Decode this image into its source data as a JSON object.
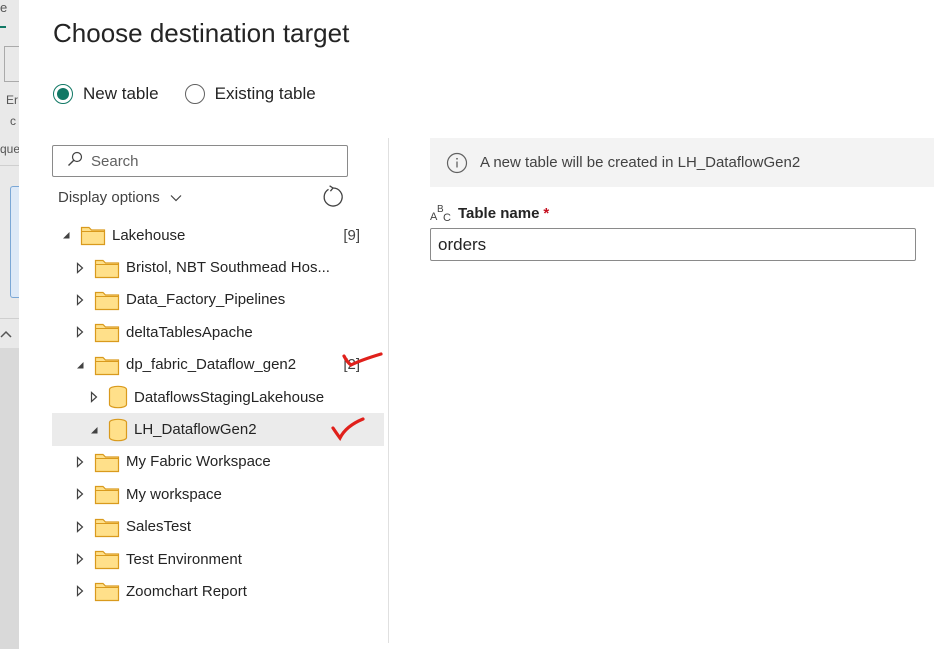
{
  "background_app": {
    "fragments": [
      "e",
      "Er",
      "c",
      "que"
    ]
  },
  "dialog": {
    "title": "Choose destination target",
    "radio_options": [
      {
        "label": "New table",
        "checked": true
      },
      {
        "label": "Existing table",
        "checked": false
      }
    ],
    "search": {
      "placeholder": "Search"
    },
    "display_options_label": "Display options",
    "tree": [
      {
        "label": "Lakehouse",
        "level": 0,
        "icon": "folder-icon",
        "expanded": true,
        "count": "[9]"
      },
      {
        "label": "Bristol, NBT Southmead Hos...",
        "level": 1,
        "icon": "folder-icon",
        "expanded": false
      },
      {
        "label": "Data_Factory_Pipelines",
        "level": 1,
        "icon": "folder-icon",
        "expanded": false
      },
      {
        "label": "deltaTablesApache",
        "level": 1,
        "icon": "folder-icon",
        "expanded": false
      },
      {
        "label": "dp_fabric_Dataflow_gen2",
        "level": 1,
        "icon": "folder-icon",
        "expanded": true,
        "count": "[2]"
      },
      {
        "label": "DataflowsStagingLakehouse",
        "level": 2,
        "icon": "database-icon",
        "expanded": false
      },
      {
        "label": "LH_DataflowGen2",
        "level": 2,
        "icon": "database-icon",
        "expanded": true,
        "selected": true
      },
      {
        "label": "My Fabric Workspace",
        "level": 1,
        "icon": "folder-icon",
        "expanded": false
      },
      {
        "label": "My workspace",
        "level": 1,
        "icon": "folder-icon",
        "expanded": false
      },
      {
        "label": "SalesTest",
        "level": 1,
        "icon": "folder-icon",
        "expanded": false
      },
      {
        "label": "Test Environment",
        "level": 1,
        "icon": "folder-icon",
        "expanded": false
      },
      {
        "label": "Zoomchart Report",
        "level": 1,
        "icon": "folder-icon",
        "expanded": false
      }
    ],
    "info_message": "A new table will be created in LH_DataflowGen2",
    "table_name": {
      "label": "Table name",
      "required_mark": "*",
      "value": "orders",
      "icon": "abc-text-icon"
    },
    "annotations": {
      "color": "#e0201b",
      "icon": "red-checkmark-icon"
    },
    "colors": {
      "accent": "#117865",
      "folder_fill": "#ffe08a",
      "folder_stroke": "#d99a1d",
      "required": "#c50f1f"
    }
  }
}
